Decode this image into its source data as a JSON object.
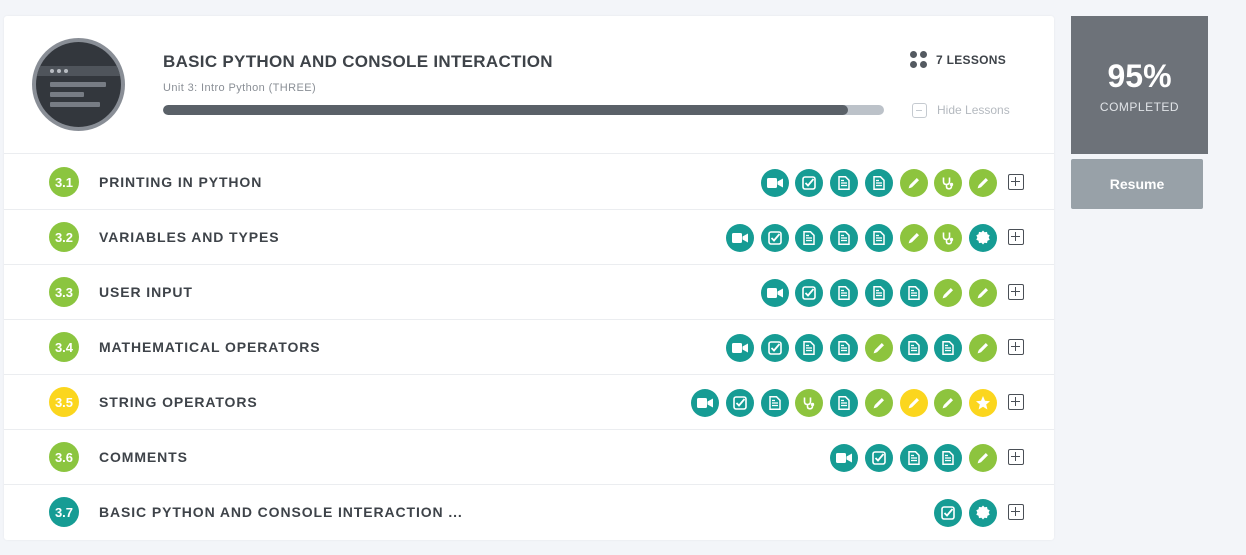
{
  "colors": {
    "teal": "#169c94",
    "green": "#8dc43e",
    "yellow": "#fbd61e",
    "badge_green": "#8bc53f",
    "badge_yellow": "#fbd61e",
    "badge_teal": "#169c94",
    "progress_fill": "#5a6168",
    "completion_bg": "#6d7279",
    "resume_bg": "#98a1a8"
  },
  "unit": {
    "title": "BASIC PYTHON AND CONSOLE INTERACTION",
    "subtitle": "Unit 3: Intro Python (THREE)",
    "progress_percent": 95,
    "lessons_count_label": "7 LESSONS",
    "hide_lessons_label": "Hide Lessons"
  },
  "completion": {
    "percent_label": "95%",
    "status_label": "COMPLETED",
    "resume_label": "Resume"
  },
  "lessons": [
    {
      "number": "3.1",
      "title": "PRINTING IN PYTHON",
      "badge": "green",
      "activities": [
        [
          "video",
          "teal"
        ],
        [
          "check",
          "teal"
        ],
        [
          "doc",
          "teal"
        ],
        [
          "doc",
          "teal"
        ],
        [
          "pencil",
          "green"
        ],
        [
          "stethoscope",
          "green"
        ],
        [
          "pencil",
          "green"
        ]
      ]
    },
    {
      "number": "3.2",
      "title": "VARIABLES AND TYPES",
      "badge": "green",
      "activities": [
        [
          "video",
          "teal"
        ],
        [
          "check",
          "teal"
        ],
        [
          "doc",
          "teal"
        ],
        [
          "doc",
          "teal"
        ],
        [
          "doc",
          "teal"
        ],
        [
          "pencil",
          "green"
        ],
        [
          "stethoscope",
          "green"
        ],
        [
          "seal",
          "teal"
        ]
      ]
    },
    {
      "number": "3.3",
      "title": "USER INPUT",
      "badge": "green",
      "activities": [
        [
          "video",
          "teal"
        ],
        [
          "check",
          "teal"
        ],
        [
          "doc",
          "teal"
        ],
        [
          "doc",
          "teal"
        ],
        [
          "doc",
          "teal"
        ],
        [
          "pencil",
          "green"
        ],
        [
          "pencil",
          "green"
        ]
      ]
    },
    {
      "number": "3.4",
      "title": "MATHEMATICAL OPERATORS",
      "badge": "green",
      "activities": [
        [
          "video",
          "teal"
        ],
        [
          "check",
          "teal"
        ],
        [
          "doc",
          "teal"
        ],
        [
          "doc",
          "teal"
        ],
        [
          "pencil",
          "green"
        ],
        [
          "doc",
          "teal"
        ],
        [
          "doc",
          "teal"
        ],
        [
          "pencil",
          "green"
        ]
      ]
    },
    {
      "number": "3.5",
      "title": "STRING OPERATORS",
      "badge": "yellow",
      "activities": [
        [
          "video",
          "teal"
        ],
        [
          "check",
          "teal"
        ],
        [
          "doc",
          "teal"
        ],
        [
          "stethoscope",
          "green"
        ],
        [
          "doc",
          "teal"
        ],
        [
          "pencil",
          "green"
        ],
        [
          "pencil",
          "yellow"
        ],
        [
          "pencil",
          "green"
        ],
        [
          "star",
          "yellow"
        ]
      ]
    },
    {
      "number": "3.6",
      "title": "COMMENTS",
      "badge": "green",
      "activities": [
        [
          "video",
          "teal"
        ],
        [
          "check",
          "teal"
        ],
        [
          "doc",
          "teal"
        ],
        [
          "doc",
          "teal"
        ],
        [
          "pencil",
          "green"
        ]
      ]
    },
    {
      "number": "3.7",
      "title": "BASIC PYTHON AND CONSOLE INTERACTION ...",
      "badge": "teal",
      "activities": [
        [
          "check",
          "teal"
        ],
        [
          "seal",
          "teal"
        ]
      ]
    }
  ]
}
